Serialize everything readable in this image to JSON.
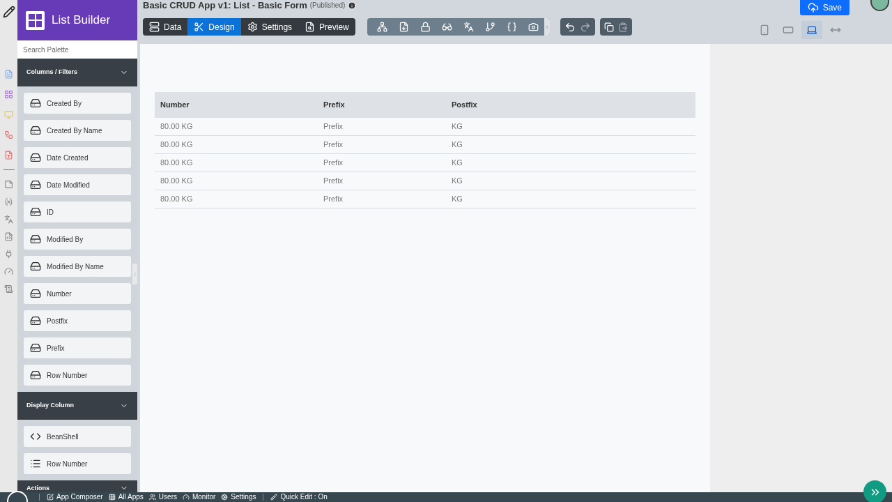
{
  "app": {
    "name": "List Builder"
  },
  "header": {
    "title": "Basic CRUD App v1: List - Basic Form",
    "status": "(Published)"
  },
  "tabs": [
    {
      "label": "Data",
      "kind": "data",
      "selected": false
    },
    {
      "label": "Design",
      "kind": "design",
      "selected": true
    },
    {
      "label": "Settings",
      "kind": "settings",
      "selected": false
    },
    {
      "label": "Preview",
      "kind": "preview",
      "selected": false
    }
  ],
  "save_button": "Save",
  "devices": [
    {
      "kind": "phone",
      "selected": false
    },
    {
      "kind": "tablet",
      "selected": false
    },
    {
      "kind": "laptop",
      "selected": true
    },
    {
      "kind": "wide",
      "selected": false
    }
  ],
  "search": {
    "placeholder": "Search Palette"
  },
  "palette": [
    {
      "title": "Columns / Filters",
      "items": [
        {
          "label": "Created By",
          "kind": "field"
        },
        {
          "label": "Created By Name",
          "kind": "field"
        },
        {
          "label": "Date Created",
          "kind": "field"
        },
        {
          "label": "Date Modified",
          "kind": "field"
        },
        {
          "label": "ID",
          "kind": "field"
        },
        {
          "label": "Modified By",
          "kind": "field"
        },
        {
          "label": "Modified By Name",
          "kind": "field"
        },
        {
          "label": "Number",
          "kind": "field"
        },
        {
          "label": "Postfix",
          "kind": "field"
        },
        {
          "label": "Prefix",
          "kind": "field"
        },
        {
          "label": "Row Number",
          "kind": "field"
        }
      ]
    },
    {
      "title": "Display Column",
      "items": [
        {
          "label": "BeanShell",
          "kind": "code"
        },
        {
          "label": "Row Number",
          "kind": "list"
        }
      ]
    },
    {
      "title": "Actions"
    }
  ],
  "table": {
    "columns": [
      "Number",
      "Prefix",
      "Postfix"
    ],
    "rows": [
      [
        "80.00 KG",
        "Prefix",
        "KG"
      ],
      [
        "80.00 KG",
        "Prefix",
        "KG"
      ],
      [
        "80.00 KG",
        "Prefix",
        "KG"
      ],
      [
        "80.00 KG",
        "Prefix",
        "KG"
      ],
      [
        "80.00 KG",
        "Prefix",
        "KG"
      ]
    ]
  },
  "bottom_bar": [
    {
      "label": "App Composer",
      "kind": "composer"
    },
    {
      "label": "All Apps",
      "kind": "apps"
    },
    {
      "label": "Users",
      "kind": "users"
    },
    {
      "label": "Monitor",
      "kind": "monitor"
    },
    {
      "label": "Settings",
      "kind": "settings"
    },
    {
      "label": "Quick Edit : On",
      "kind": "quickedit"
    }
  ]
}
